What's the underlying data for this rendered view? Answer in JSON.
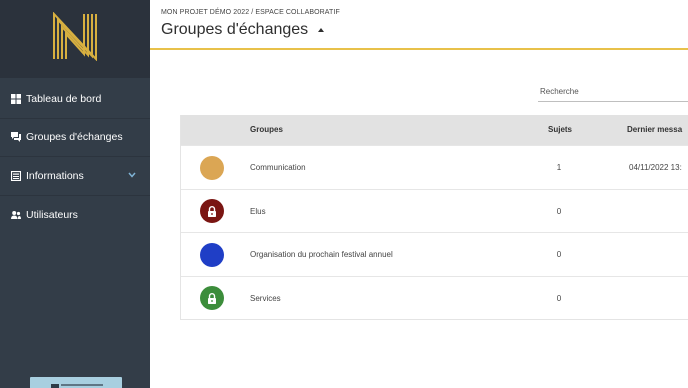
{
  "sidebar": {
    "logo_letter": "N",
    "items": [
      {
        "label": "Tableau de bord",
        "icon": "dashboard-icon"
      },
      {
        "label": "Groupes d'échanges",
        "icon": "chat-icon"
      },
      {
        "label": "Informations",
        "icon": "newspaper-icon",
        "has_submenu": true
      },
      {
        "label": "Utilisateurs",
        "icon": "users-icon"
      }
    ]
  },
  "header": {
    "breadcrumb": "MON PROJET DÉMO 2022 / ESPACE COLLABORATIF",
    "title": "Groupes d'échanges"
  },
  "search": {
    "placeholder": "Recherche"
  },
  "table": {
    "columns": [
      "Groupes",
      "Sujets",
      "Dernier messa"
    ],
    "rows": [
      {
        "name": "Communication",
        "subjects": "1",
        "last_message": "04/11/2022 13:",
        "color": "#dba654",
        "locked": false
      },
      {
        "name": "Elus",
        "subjects": "0",
        "last_message": "",
        "color": "#7a1512",
        "locked": true
      },
      {
        "name": "Organisation du prochain festival annuel",
        "subjects": "0",
        "last_message": "",
        "color": "#1f3ec6",
        "locked": false
      },
      {
        "name": "Services",
        "subjects": "0",
        "last_message": "",
        "color": "#3c8d3b",
        "locked": true
      }
    ]
  },
  "colors": {
    "sidebar_bg": "#333d48",
    "logo_bg": "#2b323c",
    "accent": "#e8c14a",
    "table_header_bg": "#e2e2e2"
  }
}
